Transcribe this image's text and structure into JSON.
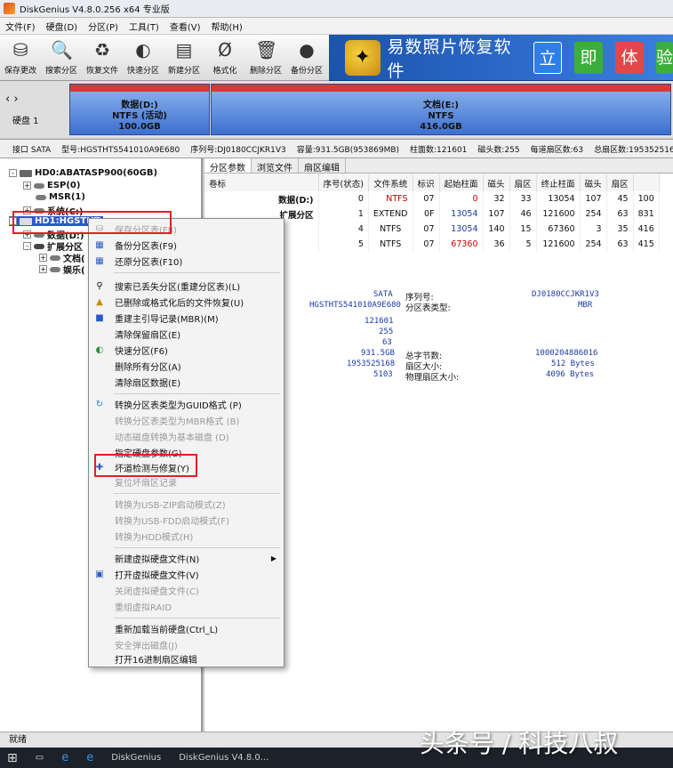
{
  "window": {
    "title": "DiskGenius V4.8.0.256 x64 专业版"
  },
  "menu": [
    "文件(F)",
    "硬盘(D)",
    "分区(P)",
    "工具(T)",
    "查看(V)",
    "帮助(H)"
  ],
  "toolbar": [
    {
      "label": "保存更改",
      "icon": "save-icon",
      "glyph": "⛁"
    },
    {
      "label": "搜索分区",
      "icon": "search-icon",
      "glyph": "🔍"
    },
    {
      "label": "恢复文件",
      "icon": "recover-icon",
      "glyph": "♻"
    },
    {
      "label": "快速分区",
      "icon": "quick-partition-icon",
      "glyph": "◐"
    },
    {
      "label": "新建分区",
      "icon": "new-partition-icon",
      "glyph": "▤"
    },
    {
      "label": "格式化",
      "icon": "format-icon",
      "glyph": "Ø"
    },
    {
      "label": "删除分区",
      "icon": "delete-icon",
      "glyph": "🗑"
    },
    {
      "label": "备份分区",
      "icon": "backup-icon",
      "glyph": "●"
    }
  ],
  "banner": {
    "text": "易数照片恢复软件",
    "tiles": [
      "立",
      "即",
      "体",
      "验"
    ]
  },
  "diskmap": {
    "disk_label": "硬盘 1",
    "partitions": [
      {
        "name": "数据(D:)",
        "fs": "NTFS (活动)",
        "size": "100.0GB"
      },
      {
        "name": "文档(E:)",
        "fs": "NTFS",
        "size": "416.0GB"
      }
    ]
  },
  "infobar": [
    "接口 SATA",
    "型号:HGSTHTS541010A9E680",
    "序列号:DJ0180CCJKR1V3",
    "容量:931.5GB(953869MB)",
    "柱面数:121601",
    "磁头数:255",
    "每道扇区数:63",
    "总扇区数:1953525168"
  ],
  "tree": {
    "hd0": "HD0:ABATASP900(60GB)",
    "esp": "ESP(0)",
    "msr": "MSR(1)",
    "sys": "系统(C:)",
    "hd1": "HD1:HGSTHT",
    "data": "数据(D:)",
    "ext": "扩展分区",
    "docs": "文档(",
    "ent": "娱乐("
  },
  "tabs": [
    "分区参数",
    "浏览文件",
    "扇区编辑"
  ],
  "table": {
    "headers": [
      "卷标",
      "序号(状态)",
      "文件系统",
      "标识",
      "起始柱面",
      "磁头",
      "扇区",
      "终止柱面",
      "磁头",
      "扇区"
    ],
    "rows": [
      {
        "vol": "数据(D:)",
        "idx": "0",
        "fs": "NTFS",
        "id": "07",
        "sc": "0",
        "sh": "32",
        "ss": "33",
        "ec": "13054",
        "eh": "107",
        "es": "45",
        "extra": "100"
      },
      {
        "vol": "扩展分区",
        "idx": "1",
        "fs": "EXTEND",
        "id": "0F",
        "sc": "13054",
        "sh": "107",
        "ss": "46",
        "ec": "121600",
        "eh": "254",
        "es": "63",
        "extra": "831"
      },
      {
        "vol": "",
        "idx": "4",
        "fs": "NTFS",
        "id": "07",
        "sc": "13054",
        "sh": "140",
        "ss": "15",
        "ec": "67360",
        "eh": "3",
        "es": "35",
        "extra": "416"
      },
      {
        "vol": "",
        "idx": "5",
        "fs": "NTFS",
        "id": "07",
        "sc": "67360",
        "sh": "36",
        "ss": "5",
        "ec": "121600",
        "eh": "254",
        "es": "63",
        "extra": "415"
      }
    ]
  },
  "details": {
    "iface": "SATA",
    "serial_label": "序列号:",
    "serial": "DJ0180CCJKR1V3",
    "model": "HGSTHTS541010A9E680",
    "ptype_label": "分区表类型:",
    "ptype": "MBR",
    "cyl": "121601",
    "heads": "255",
    "spt": "63",
    "cap": "931.5GB",
    "sectors": "1953525168",
    "extra": "5103",
    "bytes_label": "总字节数:",
    "bytes": "1000204886016",
    "sec_label": "扇区大小:",
    "sec": "512 Bytes",
    "phys_label": "物理扇区大小:",
    "phys": "4096 Bytes"
  },
  "context_menu": [
    {
      "label": "保存分区表(F8)",
      "disabled": true,
      "icon": "save-icon",
      "glyph": "⛁"
    },
    {
      "label": "备份分区表(F9)",
      "disabled": false,
      "icon": "backup-table-icon",
      "glyph": "▦"
    },
    {
      "label": "还原分区表(F10)",
      "disabled": false,
      "icon": "restore-table-icon",
      "glyph": "▦"
    },
    {
      "label": "搜索已丢失分区(重建分区表)(L)",
      "disabled": false,
      "icon": "search-icon",
      "glyph": "⚲"
    },
    {
      "label": "已删除或格式化后的文件恢复(U)",
      "disabled": false,
      "icon": "recover-icon",
      "glyph": "▲"
    },
    {
      "label": "重建主引导记录(MBR)(M)",
      "disabled": false,
      "icon": "mbr-icon",
      "glyph": "■"
    },
    {
      "label": "清除保留扇区(E)",
      "disabled": false,
      "icon": "",
      "glyph": ""
    },
    {
      "label": "快速分区(F6)",
      "disabled": false,
      "icon": "quick-partition-icon",
      "glyph": "◐"
    },
    {
      "label": "删除所有分区(A)",
      "disabled": false,
      "icon": "",
      "glyph": ""
    },
    {
      "label": "清除扇区数据(E)",
      "disabled": false,
      "icon": "",
      "glyph": ""
    },
    {
      "label": "转换分区表类型为GUID格式 (P)",
      "disabled": false,
      "icon": "convert-icon",
      "glyph": "↻"
    },
    {
      "label": "转换分区表类型为MBR格式 (B)",
      "disabled": true,
      "icon": "",
      "glyph": ""
    },
    {
      "label": "动态磁盘转换为基本磁盘 (D)",
      "disabled": true,
      "icon": "",
      "glyph": ""
    },
    {
      "label": "指定硬盘参数(G)",
      "disabled": false,
      "icon": "",
      "glyph": ""
    },
    {
      "label": "坏道检测与修复(Y)",
      "disabled": false,
      "icon": "repair-icon",
      "glyph": "✚"
    },
    {
      "label": "复位坏扇区记录",
      "disabled": true,
      "icon": "",
      "glyph": ""
    },
    {
      "label": "转换为USB-ZIP启动模式(Z)",
      "disabled": true,
      "icon": "",
      "glyph": ""
    },
    {
      "label": "转换为USB-FDD启动模式(F)",
      "disabled": true,
      "icon": "",
      "glyph": ""
    },
    {
      "label": "转换为HDD模式(H)",
      "disabled": true,
      "icon": "",
      "glyph": ""
    },
    {
      "label": "新建虚拟硬盘文件(N)",
      "disabled": false,
      "icon": "",
      "glyph": "",
      "submenu": true
    },
    {
      "label": "打开虚拟硬盘文件(V)",
      "disabled": false,
      "icon": "open-icon",
      "glyph": "▣"
    },
    {
      "label": "关闭虚拟硬盘文件(C)",
      "disabled": true,
      "icon": "",
      "glyph": ""
    },
    {
      "label": "重组虚拟RAID",
      "disabled": true,
      "icon": "",
      "glyph": ""
    },
    {
      "label": "重新加载当前硬盘(Ctrl_L)",
      "disabled": false,
      "icon": "",
      "glyph": ""
    },
    {
      "label": "安全弹出磁盘(J)",
      "disabled": true,
      "icon": "",
      "glyph": ""
    },
    {
      "label": "打开16进制扇区编辑",
      "disabled": false,
      "icon": "",
      "glyph": ""
    }
  ],
  "status": "就绪",
  "taskbar": [
    "DiskGenius",
    "DiskGenius V4.8.0..."
  ],
  "watermark": "头条号 / 科技八叔"
}
